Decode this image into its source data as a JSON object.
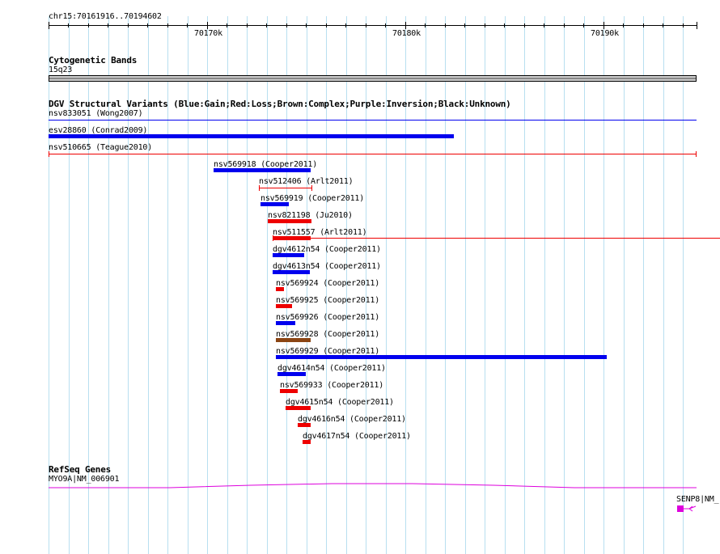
{
  "ruler": {
    "position_label": "chr15:70161916..70194602",
    "major_ticks": [
      {
        "label": "70170k"
      },
      {
        "label": "70180k"
      },
      {
        "label": "70190k"
      }
    ]
  },
  "tracks": {
    "cytoband": {
      "title": "Cytogenetic Bands",
      "band_label": "15q23"
    },
    "dgv": {
      "title": "DGV Structural Variants (Blue:Gain;Red:Loss;Brown:Complex;Purple:Inversion;Black:Unknown)",
      "features": [
        {
          "name": "nsv833051 (Wong2007)",
          "type": "gain"
        },
        {
          "name": "esv28860 (Conrad2009)",
          "type": "gain"
        },
        {
          "name": "nsv510665 (Teague2010)",
          "type": "loss"
        },
        {
          "name": "nsv569918 (Cooper2011)",
          "type": "gain"
        },
        {
          "name": "nsv512406 (Arlt2011)",
          "type": "loss"
        },
        {
          "name": "nsv569919 (Cooper2011)",
          "type": "gain"
        },
        {
          "name": "nsv821198 (Ju2010)",
          "type": "loss"
        },
        {
          "name": "nsv511557 (Arlt2011)",
          "type": "loss"
        },
        {
          "name": "dgv4612n54 (Cooper2011)",
          "type": "gain"
        },
        {
          "name": "dgv4613n54 (Cooper2011)",
          "type": "gain"
        },
        {
          "name": "nsv569924 (Cooper2011)",
          "type": "loss"
        },
        {
          "name": "nsv569925 (Cooper2011)",
          "type": "loss"
        },
        {
          "name": "nsv569926 (Cooper2011)",
          "type": "gain"
        },
        {
          "name": "nsv569928 (Cooper2011)",
          "type": "complex"
        },
        {
          "name": "nsv569929 (Cooper2011)",
          "type": "gain"
        },
        {
          "name": "dgv4614n54 (Cooper2011)",
          "type": "gain"
        },
        {
          "name": "nsv569933 (Cooper2011)",
          "type": "loss"
        },
        {
          "name": "dgv4615n54 (Cooper2011)",
          "type": "loss"
        },
        {
          "name": "dgv4616n54 (Cooper2011)",
          "type": "loss"
        },
        {
          "name": "dgv4617n54 (Cooper2011)",
          "type": "loss"
        }
      ]
    },
    "refseq": {
      "title": "RefSeq Genes",
      "genes": [
        {
          "label": "MYO9A|NM_006901"
        },
        {
          "label": "SENP8|NM_"
        }
      ]
    }
  },
  "colors": {
    "gain": "#0000ee",
    "loss": "#ee0000",
    "complex": "#8b4513",
    "inversion": "#800080",
    "unknown": "#000000",
    "grid": "#b8dff0",
    "gene": "#dd00dd"
  }
}
